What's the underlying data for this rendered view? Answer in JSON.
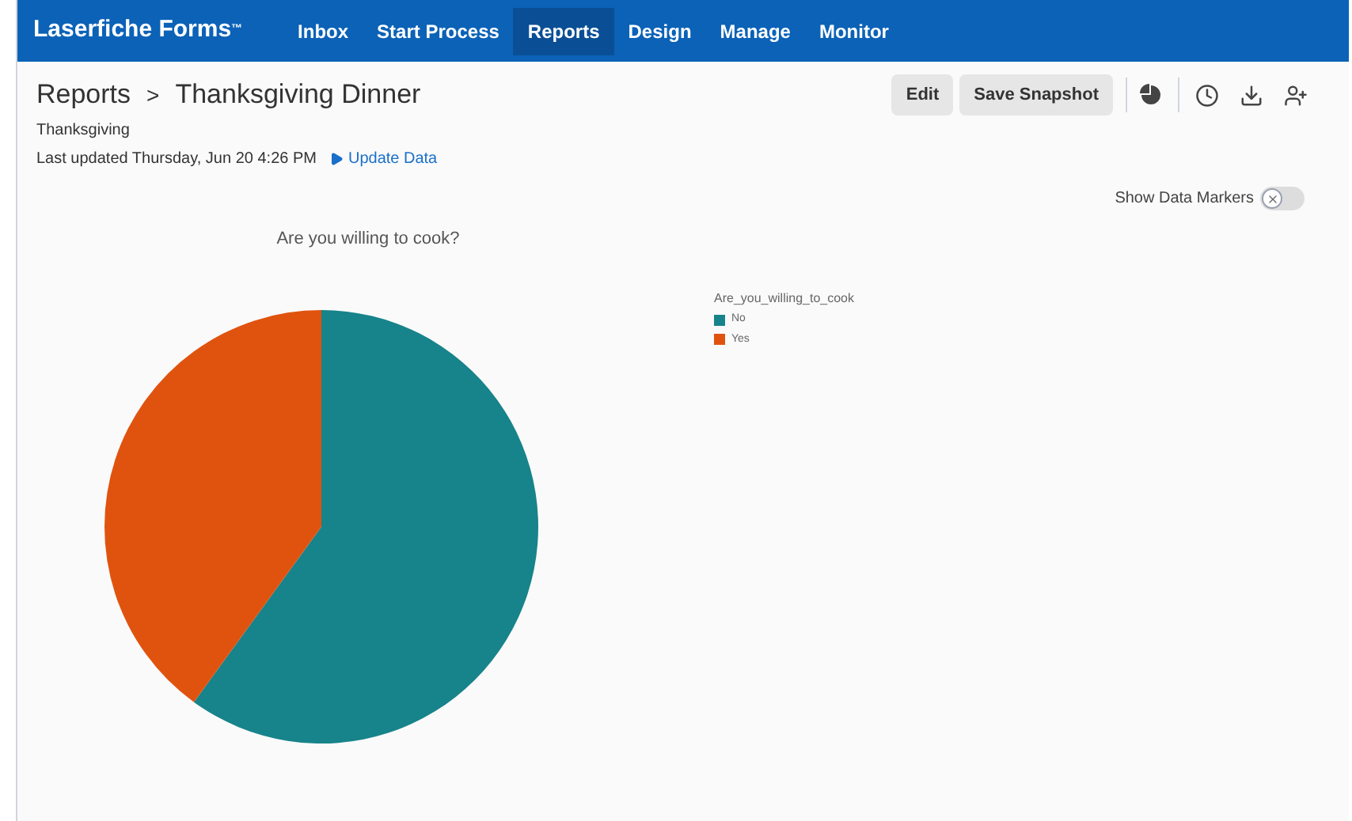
{
  "brand": {
    "name": "Laserfiche Forms",
    "mark": "™"
  },
  "nav": [
    {
      "label": "Inbox",
      "selected": false
    },
    {
      "label": "Start Process",
      "selected": false
    },
    {
      "label": "Reports",
      "selected": true
    },
    {
      "label": "Design",
      "selected": false
    },
    {
      "label": "Manage",
      "selected": false
    },
    {
      "label": "Monitor",
      "selected": false
    }
  ],
  "breadcrumb": {
    "parent": "Reports",
    "separator": ">",
    "current": "Thanksgiving Dinner"
  },
  "toolbar": {
    "buttons": [
      "Edit",
      "Save Snapshot"
    ]
  },
  "subtitle": "Thanksgiving",
  "last_updated": "Last updated Thursday, Jun 20 4:26 PM",
  "update_link": "Update Data",
  "markers_toggle": {
    "label": "Show Data Markers",
    "on": false
  },
  "chart": {
    "chart_data": {
      "type": "pie",
      "title": "Are you willing to cook?",
      "legend": "right",
      "categories": [
        "No",
        "Yes"
      ],
      "series": [
        {
          "name": "Are_you_willing_to_cook",
          "values": [
            60,
            40
          ]
        }
      ],
      "colors": [
        "#17838a",
        "#e0530f"
      ]
    }
  }
}
